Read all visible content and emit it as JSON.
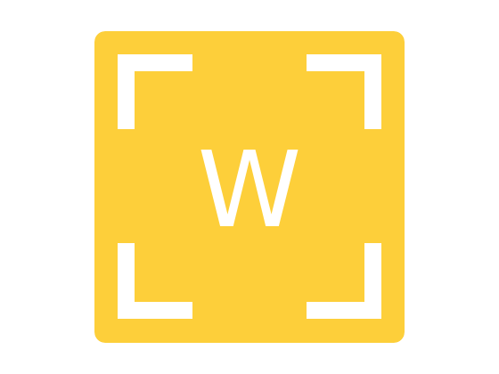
{
  "logo": {
    "letter": "W",
    "background_color": "#FDCF3A",
    "mark_color": "#FFFFFF",
    "icon": "w-viewfinder-logo-icon"
  }
}
